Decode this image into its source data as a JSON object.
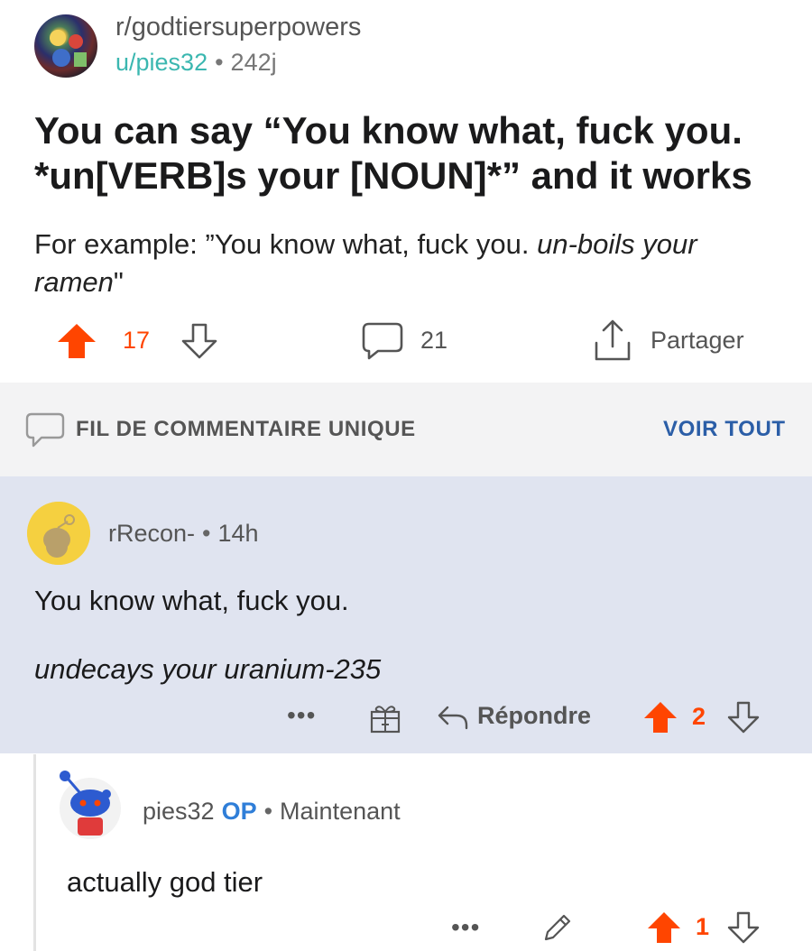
{
  "post": {
    "subreddit": "r/godtiersuperpowers",
    "author": "u/pies32",
    "separator": "•",
    "age": "242j",
    "title": "You can say “You know what, fuck you. *un[VERB]s your [NOUN]*” and it works",
    "body_prefix": "For example: ”You know what, fuck you. ",
    "body_italic": "un-boils your ramen",
    "body_suffix": "\"",
    "score": "17",
    "comments": "21",
    "share_label": "Partager"
  },
  "thread": {
    "label": "FIL DE COMMENTAIRE UNIQUE",
    "view_all": "VOIR TOUT"
  },
  "comment": {
    "user": "rRecon-",
    "separator": "•",
    "age": "14h",
    "line1": "You know what, fuck you.",
    "line2": "undecays your uranium-235",
    "more": "•••",
    "reply_label": "Répondre",
    "score": "2"
  },
  "reply": {
    "user": "pies32",
    "op_badge": "OP",
    "separator": "•",
    "age": "Maintenant",
    "text": "actually god tier",
    "more": "•••",
    "score": "1"
  },
  "colors": {
    "upvote": "#ff4500",
    "highlight_bg": "#e0e4f0",
    "link_blue": "#2b5ea7",
    "user_teal": "#3bb7b0"
  },
  "icons": [
    "upvote-icon",
    "downvote-icon",
    "comment-icon",
    "share-icon",
    "thread-icon",
    "award-icon",
    "reply-icon",
    "edit-icon"
  ]
}
